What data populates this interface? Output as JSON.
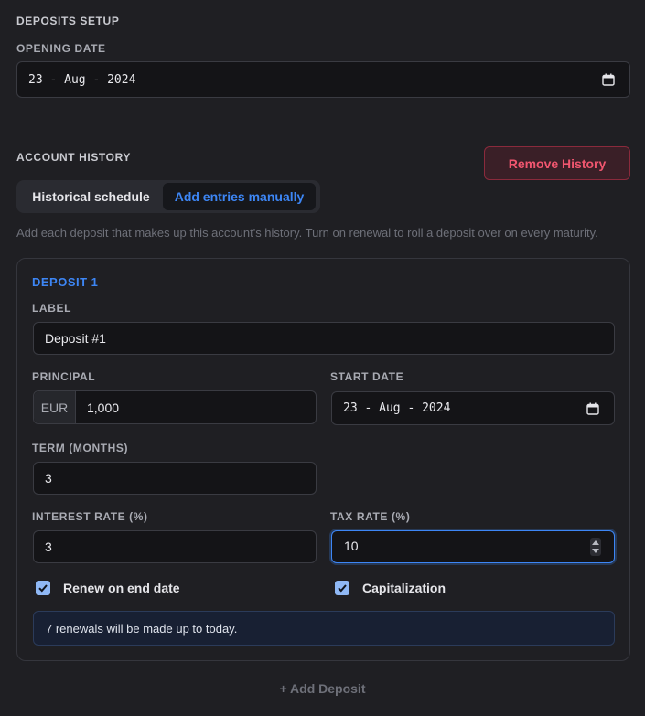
{
  "setup": {
    "title": "DEPOSITS SETUP",
    "opening_date_label": "OPENING DATE",
    "opening_date_value": "23 - Aug - 2024"
  },
  "history": {
    "title": "ACCOUNT HISTORY",
    "remove_label": "Remove History",
    "tabs": [
      {
        "label": "Historical schedule",
        "active": false
      },
      {
        "label": "Add entries manually",
        "active": true
      }
    ],
    "help_text": "Add each deposit that makes up this account's history. Turn on renewal to roll a deposit over on every maturity."
  },
  "deposit": {
    "title": "DEPOSIT 1",
    "label_label": "LABEL",
    "label_value": "Deposit #1",
    "principal_label": "PRINCIPAL",
    "currency": "EUR",
    "principal_value": "1,000",
    "start_date_label": "START DATE",
    "start_date_value": "23 - Aug - 2024",
    "term_label": "TERM (MONTHS)",
    "term_value": "3",
    "interest_label": "INTEREST RATE (%)",
    "interest_value": "3",
    "tax_label": "TAX RATE (%)",
    "tax_value": "10",
    "renew_label": "Renew on end date",
    "renew_checked": true,
    "cap_label": "Capitalization",
    "cap_checked": true,
    "info_text": "7 renewals will be made up to today."
  },
  "add_deposit_label": "+ Add Deposit",
  "colors": {
    "accent": "#3d86f5",
    "danger": "#f0566f",
    "background": "#1f1f23"
  },
  "icons": {
    "calendar": "calendar-icon",
    "spinner": "spinner-arrows-icon",
    "check": "checkmark-icon"
  }
}
